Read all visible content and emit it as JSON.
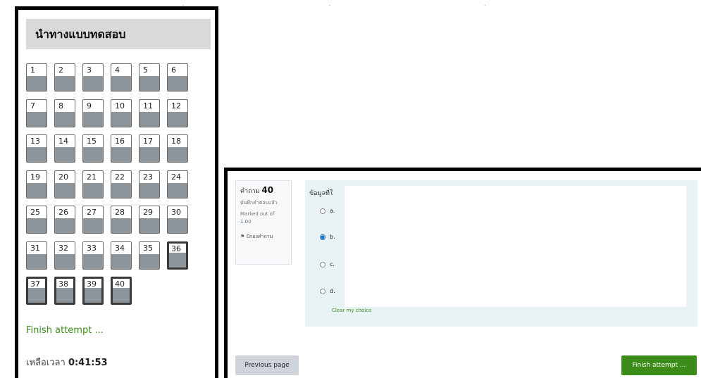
{
  "top_strip": {
    "fragments": [
      "ุ",
      "ุ",
      "ุ"
    ]
  },
  "nav": {
    "title": "นำทางแบบทดสอบ",
    "questions": [
      {
        "n": "1"
      },
      {
        "n": "2"
      },
      {
        "n": "3"
      },
      {
        "n": "4"
      },
      {
        "n": "5"
      },
      {
        "n": "6"
      },
      {
        "n": "7"
      },
      {
        "n": "8"
      },
      {
        "n": "9"
      },
      {
        "n": "10"
      },
      {
        "n": "11"
      },
      {
        "n": "12"
      },
      {
        "n": "13"
      },
      {
        "n": "14"
      },
      {
        "n": "15"
      },
      {
        "n": "16"
      },
      {
        "n": "17"
      },
      {
        "n": "18"
      },
      {
        "n": "19"
      },
      {
        "n": "20"
      },
      {
        "n": "21"
      },
      {
        "n": "22"
      },
      {
        "n": "23"
      },
      {
        "n": "24"
      },
      {
        "n": "25"
      },
      {
        "n": "26"
      },
      {
        "n": "27"
      },
      {
        "n": "28"
      },
      {
        "n": "29"
      },
      {
        "n": "30"
      },
      {
        "n": "31"
      },
      {
        "n": "32"
      },
      {
        "n": "33"
      },
      {
        "n": "34"
      },
      {
        "n": "35"
      },
      {
        "n": "36",
        "current": true
      },
      {
        "n": "37",
        "current": true
      },
      {
        "n": "38",
        "current": true
      },
      {
        "n": "39",
        "current": true
      },
      {
        "n": "40",
        "current": true
      }
    ],
    "finish_link": "Finish attempt ...",
    "timer_label": "เหลือเวลา",
    "timer_value": "0:41:53"
  },
  "question": {
    "label": "คำถาม",
    "number": "40",
    "status": "บันทึกคำตอบแล้ว",
    "marked": "Marked out of",
    "points": "1.00",
    "flag": "ปักธงคำถาม",
    "text": "ข้อมูลที่ใ",
    "options": [
      {
        "label": "a.",
        "checked": false
      },
      {
        "label": "b.",
        "checked": true
      },
      {
        "label": "c.",
        "checked": false
      },
      {
        "label": "d.",
        "checked": false
      }
    ],
    "clear_choice": "Clear my choice"
  },
  "footer": {
    "previous": "Previous page",
    "finish": "Finish attempt ..."
  },
  "colors": {
    "accent_green": "#3d8c1a",
    "answered_fill": "#8e969c",
    "radio_blue": "#0f6cbf",
    "question_bg": "#e7f3f5"
  }
}
